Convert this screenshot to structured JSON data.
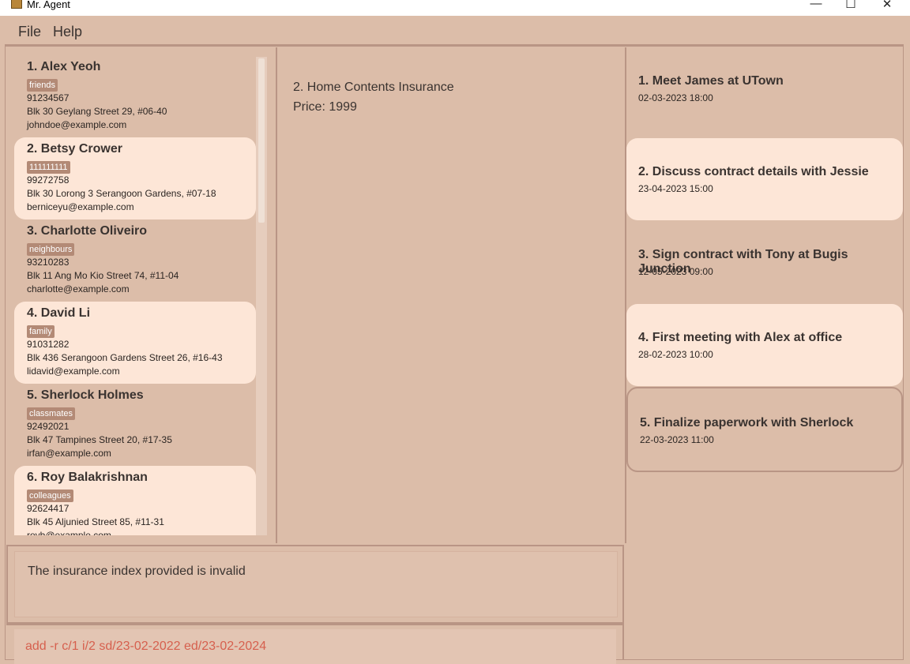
{
  "window": {
    "title": "Mr. Agent",
    "minimize": "—",
    "maximize": "☐",
    "close": "✕"
  },
  "menu": {
    "file": "File",
    "help": "Help"
  },
  "persons": [
    {
      "name": "1.  Alex Yeoh",
      "tag": "friends",
      "phone": "91234567",
      "address": "Blk 30 Geylang Street 29, #06-40",
      "email": "johndoe@example.com"
    },
    {
      "name": "2.  Betsy Crower",
      "tag": "111111111",
      "phone": "99272758",
      "address": "Blk 30 Lorong 3 Serangoon Gardens, #07-18",
      "email": "berniceyu@example.com"
    },
    {
      "name": "3.  Charlotte Oliveiro",
      "tag": "neighbours",
      "phone": "93210283",
      "address": "Blk 11 Ang Mo Kio Street 74, #11-04",
      "email": "charlotte@example.com"
    },
    {
      "name": "4.  David Li",
      "tag": "family",
      "phone": "91031282",
      "address": "Blk 436 Serangoon Gardens Street 26, #16-43",
      "email": "lidavid@example.com"
    },
    {
      "name": "5.  Sherlock Holmes",
      "tag": "classmates",
      "phone": "92492021",
      "address": "Blk 47 Tampines Street 20, #17-35",
      "email": "irfan@example.com"
    },
    {
      "name": "6.  Roy Balakrishnan",
      "tag": "colleagues",
      "phone": "92624417",
      "address": "Blk 45 Aljunied Street 85, #11-31",
      "email": "royb@example.com"
    }
  ],
  "insurance": {
    "title": "2.  Home Contents Insurance",
    "price": "Price: 1999"
  },
  "meetings": [
    {
      "title": "1. Meet James at UTown",
      "time": "02-03-2023 18:00"
    },
    {
      "title": "2. Discuss contract details with Jessie",
      "time": "23-04-2023 15:00"
    },
    {
      "title": "3. Sign contract with Tony at Bugis Junction",
      "time": "12-05-2023 09:00"
    },
    {
      "title": "4. First meeting with Alex at office",
      "time": "28-02-2023 10:00"
    },
    {
      "title": "5. Finalize paperwork with Sherlock",
      "time": "22-03-2023 11:00"
    }
  ],
  "result": {
    "message": "The insurance index provided is invalid"
  },
  "command": {
    "value": "add -r c/1 i/2 sd/23-02-2022 ed/23-02-2024"
  }
}
